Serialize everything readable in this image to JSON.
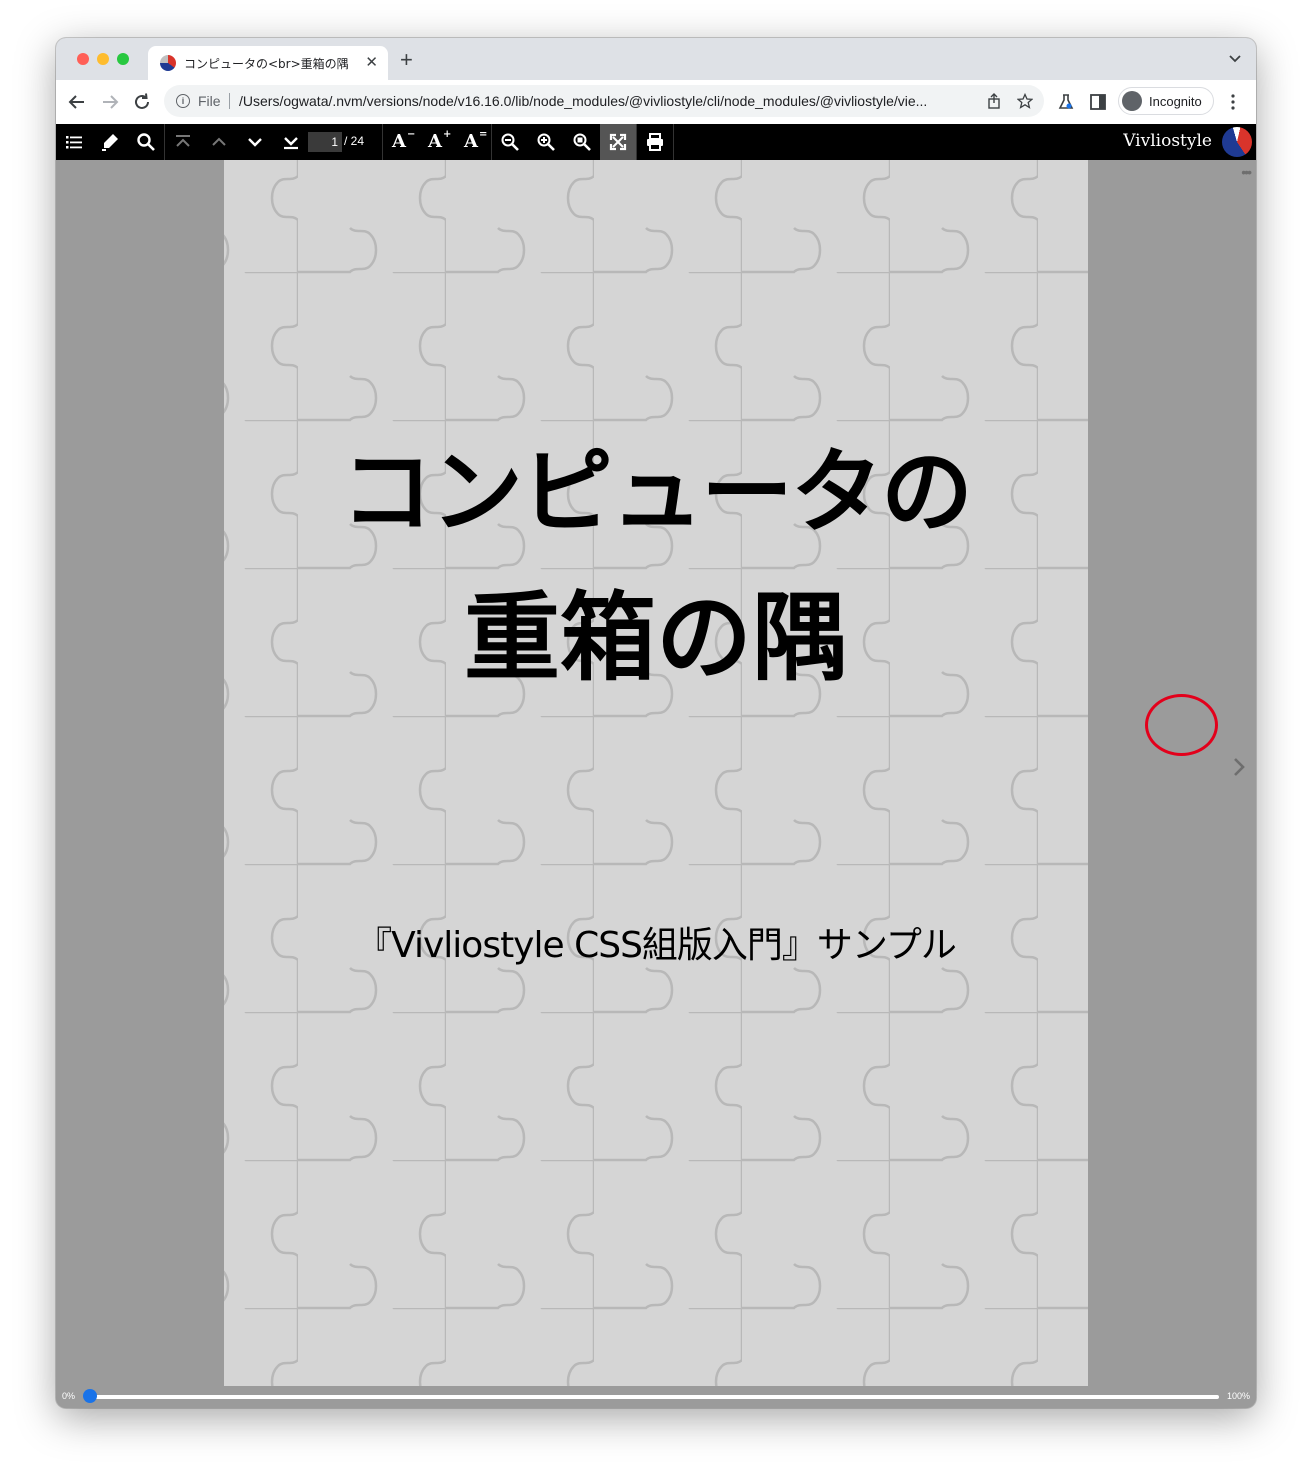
{
  "browser": {
    "tab": {
      "title": "コンピュータの<br>重箱の隅",
      "close": "✕"
    },
    "new_tab": "+",
    "address": {
      "scheme_label": "File",
      "url": "/Users/ogwata/.nvm/versions/node/v16.16.0/lib/node_modules/@vivliostyle/cli/node_modules/@vivliostyle/vie..."
    },
    "incognito_label": "Incognito",
    "colors": {
      "close": "#ff5f57",
      "minimize": "#febc2e",
      "zoom": "#28c840"
    }
  },
  "viewer": {
    "page": {
      "current": "1",
      "total": "/ 24"
    },
    "font_buttons": {
      "decrease": "A",
      "decrease_sup": "−",
      "increase": "A",
      "increase_sup": "+",
      "reset": "A",
      "reset_sup": "="
    },
    "brand": "Vivliostyle",
    "progress": {
      "start_label": "0%",
      "end_label": "100%",
      "value_percent": 0
    }
  },
  "document": {
    "title_line1": "コンピュータの",
    "title_line2": "重箱の隅",
    "subtitle": "『Vivliostyle CSS組版入門』サンプル"
  },
  "icons": {
    "more": "•••"
  }
}
